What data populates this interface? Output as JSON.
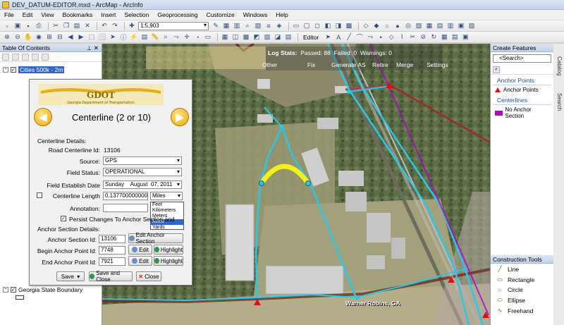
{
  "window": {
    "title": "DEV_DATUM-EDITOR.mxd - ArcMap - ArcInfo"
  },
  "menu": [
    "File",
    "Edit",
    "View",
    "Bookmarks",
    "Insert",
    "Selection",
    "Geoprocessing",
    "Customize",
    "Windows",
    "Help"
  ],
  "toolbar": {
    "scale": "1:5,903",
    "editor_label": "Editor"
  },
  "toc": {
    "title": "Table Of Contents",
    "layers": [
      {
        "label": "Cities 500k - 2m",
        "checked": true,
        "selected": true
      },
      {
        "label": "Georgia State Boundary",
        "checked": true,
        "selected": false
      }
    ]
  },
  "dialog": {
    "title": "Centerline (2 or 10)",
    "details_label": "Centerline Details:",
    "road_id_label": "Road Centerline Id:",
    "road_id_value": "13106",
    "source_label": "Source:",
    "source_value": "GPS",
    "field_status_label": "Field Status:",
    "field_status_value": "OPERATIONAL",
    "field_date_label": "Field Establish Date",
    "field_date_day": "Sunday",
    "field_date_month": "August",
    "field_date_rest": "07, 2011",
    "length_label": "Centerline Length",
    "length_value": "0.137700000000",
    "length_unit": "Miles",
    "annotation_label": "Annotation:",
    "units_options": [
      "Feet",
      "Kilometers",
      "Meters",
      "Miles",
      "Yards"
    ],
    "units_selected": "Miles",
    "persist_label": "Persist Changes To Anchor Section and",
    "anchor_details_label": "Anchor Section Details:",
    "anchor_section_label": "Anchor Section Id:",
    "anchor_section_value": "13106",
    "edit_anchor_btn": "Edit Anchor Section",
    "begin_anchor_label": "Begin Anchor Point Id:",
    "begin_anchor_value": "7748",
    "end_anchor_label": "End Anchor Point Id:",
    "end_anchor_value": "7921",
    "edit_btn": "Edit",
    "highlight_btn": "Highlight",
    "save_btn": "Save",
    "save_close_btn": "Save and Close",
    "close_btn": "Close"
  },
  "log": {
    "label": "Log Stats:",
    "passed": "Passed: 88",
    "failed": "Failed: 0",
    "warnings": "Warnings: 0",
    "other_btn": "Other",
    "fix_btn": "Fix",
    "generate_btn": "Generate AS",
    "retire_btn": "Retire",
    "merge_btn": "Merge",
    "settings_btn": "Settings"
  },
  "map": {
    "place_label": "Warner Robins, GA"
  },
  "create_features": {
    "title": "Create Features",
    "search": "<Search>",
    "groups": [
      {
        "name": "Anchor Points",
        "items": [
          {
            "label": "Anchor Points"
          }
        ]
      },
      {
        "name": "Centerlines",
        "items": [
          {
            "label": "No Anchor Section"
          }
        ]
      }
    ]
  },
  "construction_tools": {
    "title": "Construction Tools",
    "items": [
      "Line",
      "Rectangle",
      "Circle",
      "Ellipse",
      "Freehand"
    ]
  },
  "side_tabs": [
    "Catalog",
    "Search"
  ],
  "colors": {
    "centerline": "#29c8e8",
    "selected_curve": "#f2f21a",
    "road_red": "#c01818",
    "highlight": "#3166c5"
  }
}
